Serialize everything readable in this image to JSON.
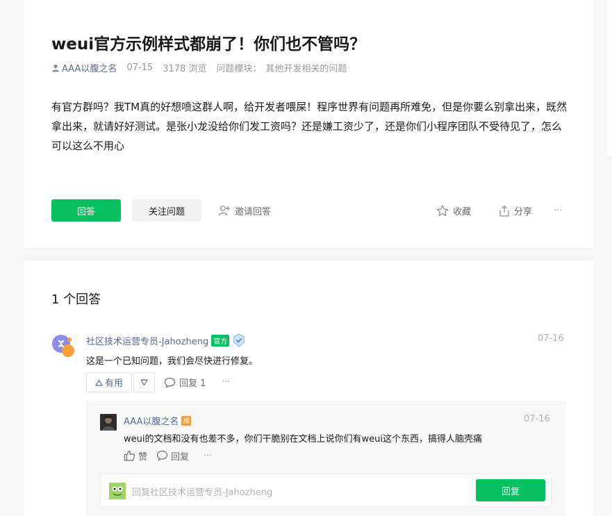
{
  "question": {
    "title": "weui官方示例样式都崩了！你们也不管吗？",
    "author": "AAA以腹之名",
    "date": "07-15",
    "views": "3178 浏览",
    "module_label": "问题模块：",
    "module_value": "其他开发相关的问题",
    "content": "有官方群吗？我TM真的好想喷这群人啊，给开发者喂屎！程序世界有问题再所难免，但是你要么别拿出来，既然拿出来，就请好好测试。是张小龙没给你们发工资吗？还是嫌工资少了，还是你们小程序团队不受待见了，怎么可以这么不用心",
    "actions": {
      "answer": "回答",
      "follow": "关注问题",
      "invite": "邀请回答",
      "collect": "收藏",
      "share": "分享",
      "more": "···"
    }
  },
  "answers": {
    "count_label": "1 个回答",
    "items": [
      {
        "name": "社区技术运营专员-Jahozheng",
        "badge": "官方",
        "date": "07-16",
        "text": "这是一个已知问题，我们会尽快进行修复。",
        "useful": "有用",
        "reply": "回复 1",
        "more": "···",
        "replies": [
          {
            "name": "AAA以腹之名",
            "badge": "楼",
            "date": "07-16",
            "text": "weui的文档和没有也差不多，你们干脆别在文档上说你们有weui这个东西，搞得人脑壳痛",
            "like": "赞",
            "reply": "回复",
            "more": "···"
          }
        ],
        "reply_input": {
          "placeholder": "回复社区技术运营专员-Jahozheng",
          "button": "回复"
        }
      }
    ]
  },
  "colors": {
    "accent": "#07c160",
    "link": "#576b95",
    "badge_orange": "#fa9d3b"
  }
}
